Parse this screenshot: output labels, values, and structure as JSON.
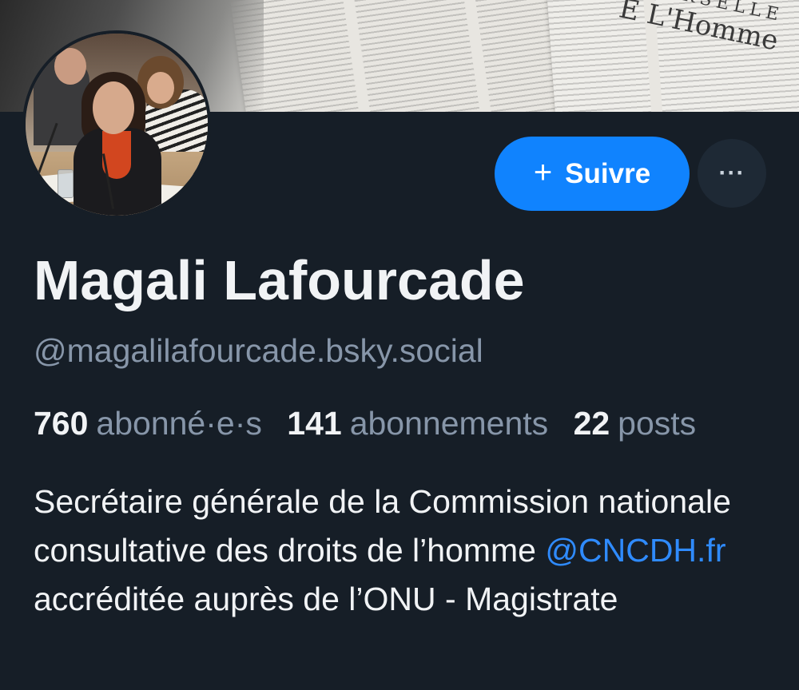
{
  "banner": {
    "text_line1": "ERSELLE",
    "text_line2": "E L'Homme"
  },
  "profile": {
    "display_name": "Magali Lafourcade",
    "handle": "@magalilafourcade.bsky.social"
  },
  "actions": {
    "follow_icon": "+",
    "follow_label": "Suivre",
    "more_label": "···"
  },
  "stats": {
    "followers_count": "760",
    "followers_label": "abonné·e·s",
    "following_count": "141",
    "following_label": "abonnements",
    "posts_count": "22",
    "posts_label": "posts"
  },
  "bio": {
    "part1": "Secrétaire générale de la Commission nationale consultative des droits de l’homme ",
    "mention": "@CNCDH.fr",
    "part2": " accréditée auprès de l’ONU - Magistrate"
  },
  "colors": {
    "background": "#161e27",
    "accent": "#1083fe",
    "muted_text": "#8796a9",
    "link": "#2f8bff"
  }
}
